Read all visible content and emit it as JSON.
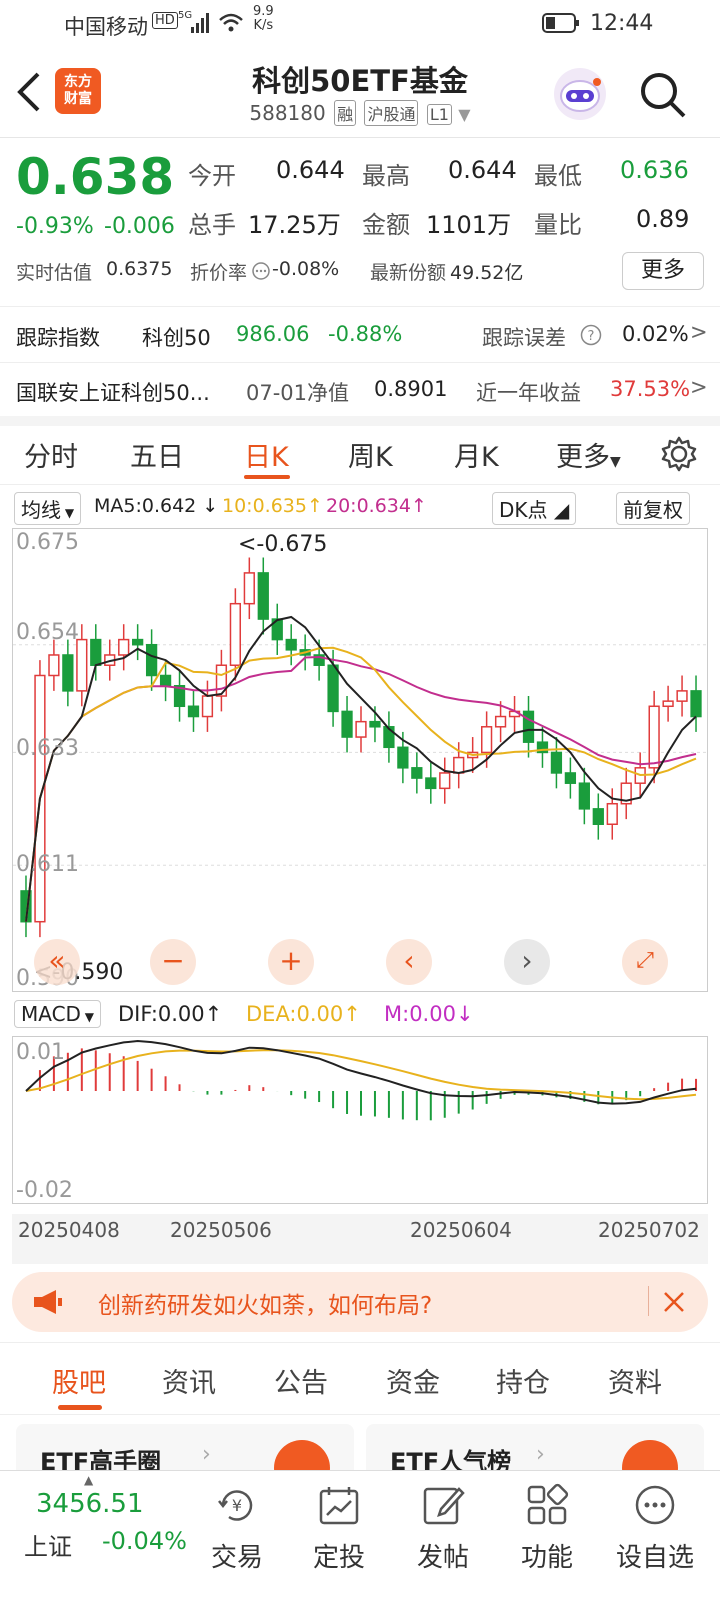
{
  "status_bar": {
    "carrier": "中国移动",
    "hd": "HD",
    "net": "5G",
    "speed_value": "9.9",
    "speed_unit": "K/s",
    "time": "12:44"
  },
  "header": {
    "logo_line1": "东方",
    "logo_line2": "财富",
    "title": "科创50ETF基金",
    "code": "588180",
    "tag1": "融",
    "tag2": "沪股通",
    "tag3": "L1"
  },
  "quote": {
    "price": "0.638",
    "change_pct": "-0.93%",
    "change": "-0.006",
    "open_label": "今开",
    "open": "0.644",
    "high_label": "最高",
    "high": "0.644",
    "low_label": "最低",
    "low": "0.636",
    "vol_label": "总手",
    "vol": "17.25万",
    "amount_label": "金额",
    "amount": "1101万",
    "ratio_label": "量比",
    "ratio": "0.89",
    "est_label": "实时估值",
    "est": "0.6375",
    "discount_label": "折价率",
    "discount": "-0.08%",
    "shares_label": "最新份额",
    "shares": "49.52亿",
    "more_button": "更多"
  },
  "tracking": {
    "index_label": "跟踪指数",
    "index_name": "科创50",
    "index_value": "986.06",
    "index_change": "-0.88%",
    "error_label": "跟踪误差",
    "error_value": "0.02%",
    "fund_name": "国联安上证科创50...",
    "nav_label": "07-01净值",
    "nav_value": "0.8901",
    "return_label": "近一年收益",
    "return_value": "37.53%"
  },
  "tabs": [
    "分时",
    "五日",
    "日K",
    "周K",
    "月K",
    "更多"
  ],
  "ma_bar": {
    "selector": "均线",
    "ma5": "MA5:0.642",
    "ma10": "10:0.635",
    "ma20": "20:0.634",
    "dk": "DK点",
    "adjust": "前复权"
  },
  "chart_labels": {
    "y1": "0.675",
    "y2": "0.654",
    "y3": "0.633",
    "y4": "0.611",
    "y5": "0.590",
    "max_label": "<-0.675",
    "min_label": "<-0.590"
  },
  "macd_bar": {
    "selector": "MACD",
    "dif": "DIF:0.00",
    "dea": "DEA:0.00",
    "m": "M:0.00",
    "y_top": "0.01",
    "y_bottom": "-0.02"
  },
  "dates": [
    "20250408",
    "20250506",
    "20250604",
    "20250702"
  ],
  "banner": {
    "text": "创新药研发如火如荼，如何布局?"
  },
  "bottom_tabs": [
    "股吧",
    "资讯",
    "公告",
    "资金",
    "持仓",
    "资料"
  ],
  "cards": {
    "left": "ETF高手圈",
    "right": "ETF人气榜"
  },
  "nav": {
    "index_value": "3456.51",
    "index_name": "上证",
    "index_change": "-0.04%",
    "items": [
      "交易",
      "定投",
      "发帖",
      "功能",
      "设自选"
    ]
  },
  "colors": {
    "up": "#e03b3b",
    "down": "#1a9d3c",
    "accent": "#e8541d",
    "ma5": "#222222",
    "ma10": "#e8b21d",
    "ma20": "#c22e8e"
  },
  "chart_data": {
    "type": "candlestick",
    "y_range": [
      0.59,
      0.675
    ],
    "close_series": [
      0.6,
      0.648,
      0.652,
      0.645,
      0.655,
      0.65,
      0.652,
      0.655,
      0.654,
      0.648,
      0.646,
      0.642,
      0.64,
      0.644,
      0.65,
      0.662,
      0.668,
      0.659,
      0.655,
      0.653,
      0.652,
      0.65,
      0.641,
      0.636,
      0.639,
      0.638,
      0.634,
      0.63,
      0.628,
      0.626,
      0.629,
      0.632,
      0.633,
      0.638,
      0.64,
      0.641,
      0.635,
      0.633,
      0.629,
      0.627,
      0.622,
      0.619,
      0.623,
      0.627,
      0.63,
      0.642,
      0.643,
      0.645,
      0.64
    ]
  }
}
